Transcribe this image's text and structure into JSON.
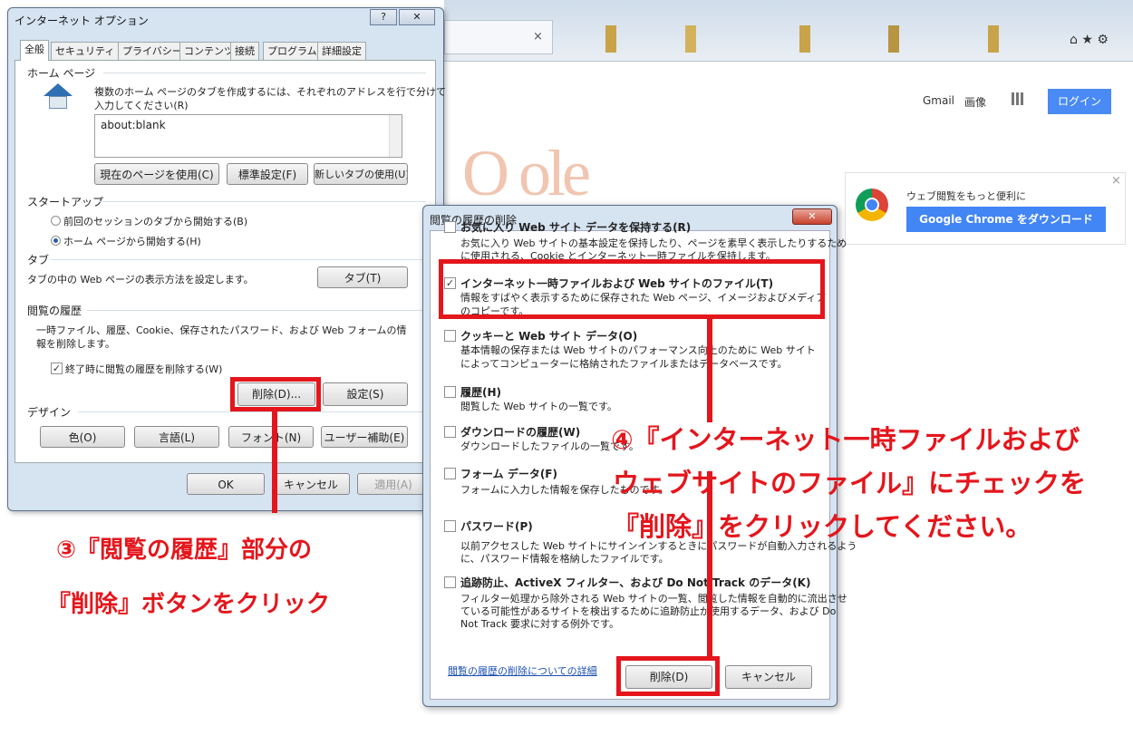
{
  "browser": {
    "tab_close": "×",
    "home_star_gear": "⌂ ★ ⚙",
    "gmail": "Gmail",
    "images": "画像",
    "login": "ログイン",
    "google_partial": "O ole",
    "promo_text": "ウェブ閲覧をもっと便利に",
    "promo_button": "Google Chrome をダウンロード",
    "promo_close": "×"
  },
  "options": {
    "title": "インターネット オプション",
    "help": "?",
    "close": "✕",
    "tabs": [
      "全般",
      "セキュリティ",
      "プライバシー",
      "コンテンツ",
      "接続",
      "プログラム",
      "詳細設定"
    ],
    "home_label": "ホーム ページ",
    "home_desc_1": "複数のホーム ページのタブを作成するには、それぞれのアドレスを行で分けて",
    "home_desc_2": "入力してください(R)",
    "home_value": "about:blank",
    "btn_current": "現在のページを使用(C)",
    "btn_default": "標準設定(F)",
    "btn_newtab": "新しいタブの使用(U)",
    "startup_label": "スタートアップ",
    "radio_prev": "前回のセッションのタブから開始する(B)",
    "radio_home": "ホーム ページから開始する(H)",
    "tabs_label": "タブ",
    "tabs_desc": "タブの中の Web ページの表示方法を設定します。",
    "btn_tabs": "タブ(T)",
    "history_label": "閲覧の履歴",
    "history_desc_1": "一時ファイル、履歴、Cookie、保存されたパスワード、および Web フォームの情",
    "history_desc_2": "報を削除します。",
    "chk_delete_on_exit": "終了時に閲覧の履歴を削除する(W)",
    "btn_delete": "削除(D)...",
    "btn_settings": "設定(S)",
    "design_label": "デザイン",
    "btn_colors": "色(O)",
    "btn_languages": "言語(L)",
    "btn_fonts": "フォント(N)",
    "btn_accessibility": "ユーザー補助(E)",
    "btn_ok": "OK",
    "btn_cancel": "キャンセル",
    "btn_apply": "適用(A)"
  },
  "delete_dialog": {
    "title": "閲覧の履歴の削除",
    "close": "✕",
    "items": [
      {
        "title": "お気に入り Web サイト データを保持する(R)",
        "desc1": "お気に入り Web サイトの基本設定を保持したり、ページを素早く表示したりするため",
        "desc2": "に使用される、Cookie とインターネット一時ファイルを保持します。",
        "checked": ""
      },
      {
        "title": "インターネット一時ファイルおよび Web サイトのファイル(T)",
        "desc1": "情報をすばやく表示するために保存された Web ページ、イメージおよびメディア",
        "desc2": "のコピーです。",
        "checked": "✓"
      },
      {
        "title": "クッキーと Web サイト データ(O)",
        "desc1": "基本情報の保存または Web サイトのパフォーマンス向上のために Web サイト",
        "desc2": "によってコンピューターに格納されたファイルまたはデータベースです。",
        "checked": ""
      },
      {
        "title": "履歴(H)",
        "desc1": "閲覧した Web サイトの一覧です。",
        "desc2": "",
        "checked": ""
      },
      {
        "title": "ダウンロードの履歴(W)",
        "desc1": "ダウンロードしたファイルの一覧です。",
        "desc2": "",
        "checked": ""
      },
      {
        "title": "フォーム データ(F)",
        "desc1": "フォームに入力した情報を保存したものです。",
        "desc2": "",
        "checked": ""
      },
      {
        "title": "パスワード(P)",
        "desc1": "以前アクセスした Web サイトにサインインするときにパスワードが自動入力されるよう",
        "desc2": "に、パスワード情報を格納したファイルです。",
        "checked": ""
      },
      {
        "title": "追跡防止、ActiveX フィルター、および Do Not Track のデータ(K)",
        "desc1": "フィルター処理から除外される Web サイトの一覧、閲覧した情報を自動的に流出させ",
        "desc2": "ている可能性があるサイトを検出するために追跡防止が使用するデータ、および Do",
        "desc3": "Not Track 要求に対する例外です。",
        "checked": ""
      }
    ],
    "link": "閲覧の履歴の削除についての詳細",
    "btn_delete": "削除(D)",
    "btn_cancel": "キャンセル"
  },
  "annotations": {
    "step3_line1": "③『閲覧の履歴』部分の",
    "step3_line2": "『削除』ボタンをクリック",
    "step4_line1": "④『インターネット一時ファイルおよび",
    "step4_line2": "ウェブサイトのファイル』にチェックを",
    "step4_line3": "『削除』をクリックしてください。"
  },
  "colors": {
    "accent_red": "#e4161c",
    "login_blue": "#4a8af4",
    "chrome_button": "#4285f4"
  }
}
